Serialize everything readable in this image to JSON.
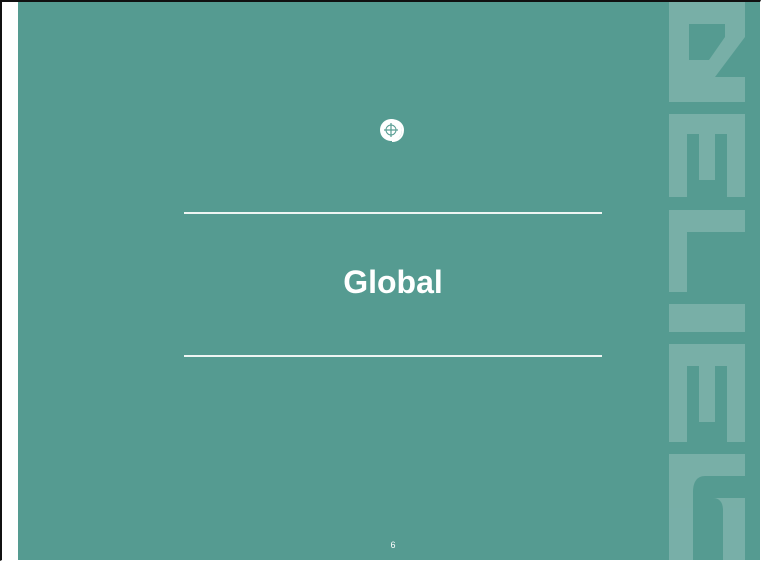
{
  "slide": {
    "title": "Global",
    "page_number": "6",
    "watermark_text": "SEILER",
    "logo_icon": "crosshair-circle-icon"
  },
  "colors": {
    "background": "#559b91",
    "watermark": "#7fb3ab",
    "rule": "#eef5f3",
    "text": "#ffffff"
  }
}
